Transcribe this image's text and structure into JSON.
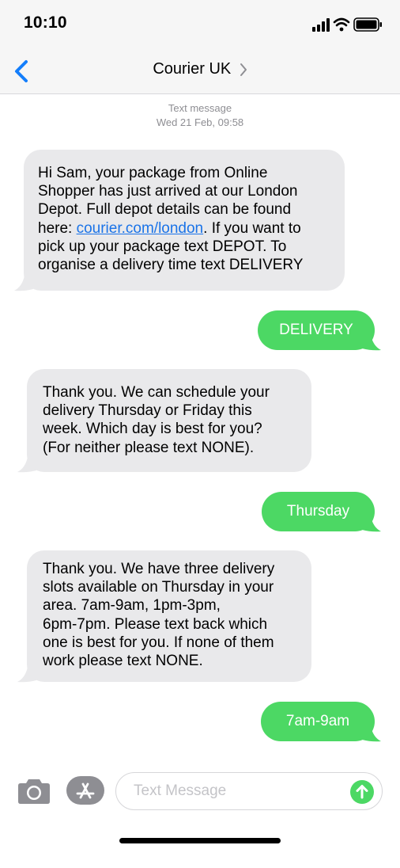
{
  "status_bar": {
    "time": "10:10",
    "icons": [
      "signal-icon",
      "wifi-icon",
      "battery-icon"
    ]
  },
  "nav": {
    "back_icon": "chevron-left-icon",
    "title": "Courier UK",
    "title_chevron_icon": "chevron-right-icon"
  },
  "timestamp": {
    "label": "Text message",
    "date": "Wed 21 Feb, 09:58"
  },
  "messages": [
    {
      "direction": "incoming",
      "lines": [
        "Hi Sam, your package from Online",
        "Shopper has just arrived at our London",
        "Depot. Full depot details can be found"
      ],
      "line4_prefix": "here: ",
      "link": "courier.com/london",
      "line4_suffix": ". If you want to",
      "lines_after": [
        "pick up your package text DEPOT. To",
        "organise a delivery time text DELIVERY"
      ]
    },
    {
      "direction": "outgoing",
      "text": "DELIVERY"
    },
    {
      "direction": "incoming",
      "lines": [
        "Thank you. We can schedule your",
        "delivery Thursday or Friday this",
        "week. Which day is best for you?",
        "(For neither please text NONE)."
      ]
    },
    {
      "direction": "outgoing",
      "text": "Thursday"
    },
    {
      "direction": "incoming",
      "lines": [
        "Thank you. We have three delivery",
        "slots available on Thursday in your",
        "area. 7am-9am, 1pm-3pm,",
        "6pm-7pm. Please text back which",
        "one is best for you. If none of them",
        "work please text NONE."
      ]
    },
    {
      "direction": "outgoing",
      "text": "7am-9am"
    }
  ],
  "input_bar": {
    "camera_icon": "camera-icon",
    "appstore_icon": "app-store-icon",
    "placeholder": "Text Message",
    "value": "",
    "send_icon": "send-arrow-icon"
  },
  "colors": {
    "incoming_bubble": "#e9e9eb",
    "outgoing_bubble": "#4cd864",
    "link": "#1a73e8",
    "ios_blue": "#147efb",
    "meta_gray": "#8e8e93"
  }
}
